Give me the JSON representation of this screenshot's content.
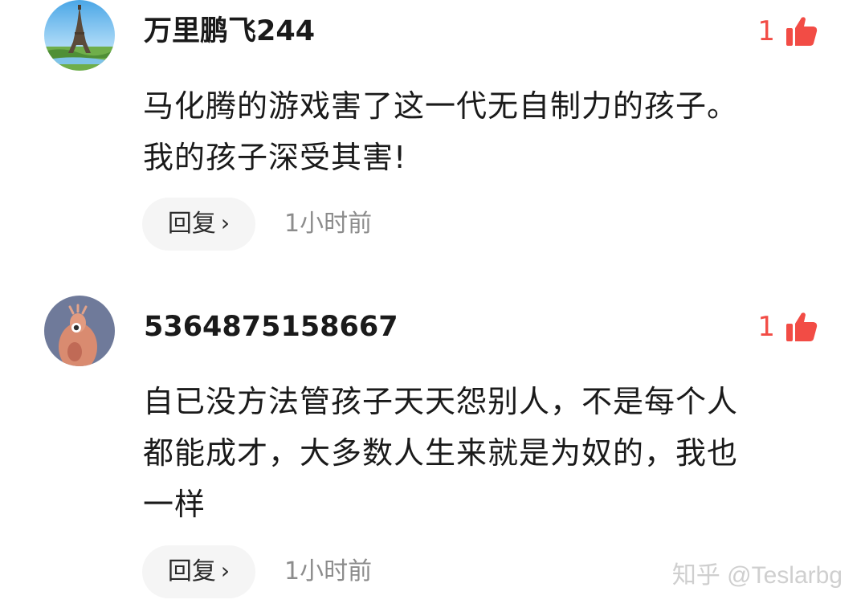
{
  "comments": [
    {
      "username": "万里鹏飞244",
      "avatar": "eiffel-tower-avatar",
      "like_count": "1",
      "like_icon": "thumbs-up-icon",
      "lines": [
        "马化腾的游戏害了这一代无自制力的孩子。",
        "我的孩子深受其害!"
      ],
      "reply_label": "回复",
      "reply_icon": "chevron-right-icon",
      "timestamp": "1小时前"
    },
    {
      "username": "5364875158667",
      "avatar": "cartoon-shrimp-avatar",
      "like_count": "1",
      "like_icon": "thumbs-up-icon",
      "lines": [
        "自已没方法管孩子天天怨别人，不是每个人",
        "都能成才，大多数人生来就是为奴的，我也",
        "一样"
      ],
      "reply_label": "回复",
      "reply_icon": "chevron-right-icon",
      "timestamp": "1小时前"
    }
  ],
  "watermark": "知乎 @Teslarbg",
  "colors": {
    "like_red": "#f24c45",
    "reply_bg": "#f5f5f5",
    "timestamp_gray": "#8c8c8c",
    "text_dark": "#1a1a1a"
  }
}
